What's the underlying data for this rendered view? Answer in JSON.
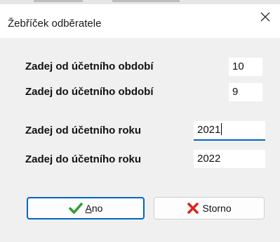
{
  "dialog": {
    "title": "Žebříček odběratele",
    "close_icon": "close-icon"
  },
  "fields": [
    {
      "label": "Zadej od účetního období",
      "value": "10"
    },
    {
      "label": "Zadej do účetního období",
      "value": "9"
    },
    {
      "label": "Zadej od účetního roku",
      "value": "2021"
    },
    {
      "label": "Zadej do účetního roku",
      "value": "2022"
    }
  ],
  "buttons": {
    "ok": {
      "mnemonic": "A",
      "rest": "no",
      "icon": "checkmark-icon",
      "icon_color": "#2e9e2e"
    },
    "cancel": {
      "label": "Storno",
      "icon": "x-icon",
      "icon_color": "#d9261c"
    }
  },
  "colors": {
    "accent": "#0067c0"
  }
}
